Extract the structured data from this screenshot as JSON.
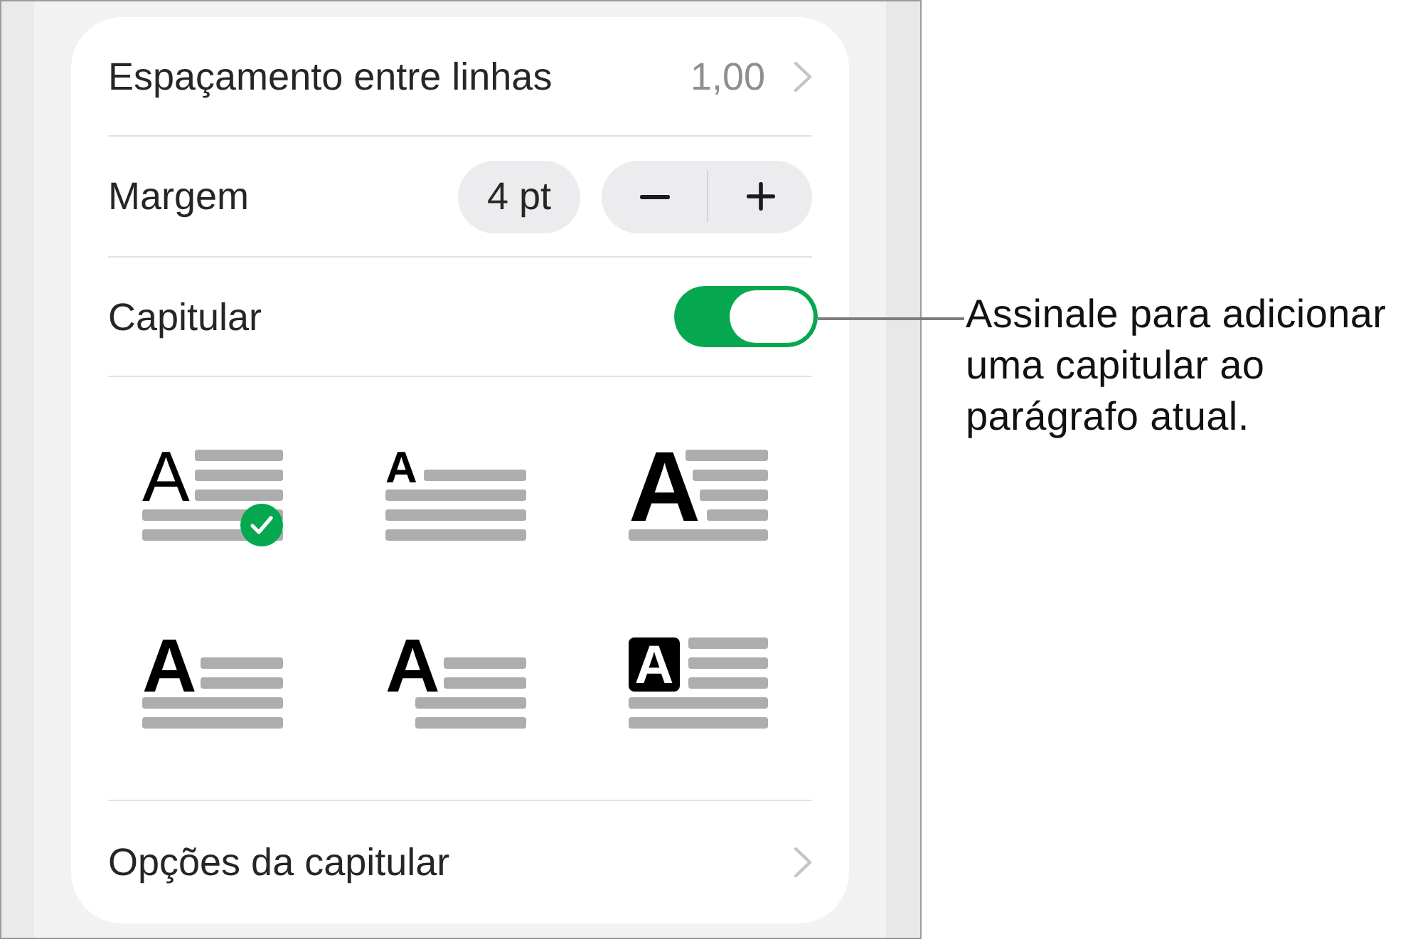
{
  "panel": {
    "line_spacing": {
      "label": "Espaçamento entre linhas",
      "value": "1,00"
    },
    "margin": {
      "label": "Margem",
      "value": "4 pt"
    },
    "drop_cap": {
      "label": "Capitular",
      "on": true
    },
    "drop_cap_styles": [
      {
        "kind": "light",
        "letter": "A",
        "selected": true
      },
      {
        "kind": "small",
        "letter": "A",
        "selected": false
      },
      {
        "kind": "large",
        "letter": "A",
        "selected": false
      },
      {
        "kind": "bold",
        "letter": "A",
        "selected": false
      },
      {
        "kind": "hanging",
        "letter": "A",
        "selected": false
      },
      {
        "kind": "boxed",
        "letter": "A",
        "selected": false
      }
    ],
    "drop_cap_options": {
      "label": "Opções da capitular"
    }
  },
  "callout": {
    "text": "Assinale para adicionar uma capitular ao parágrafo atual."
  }
}
